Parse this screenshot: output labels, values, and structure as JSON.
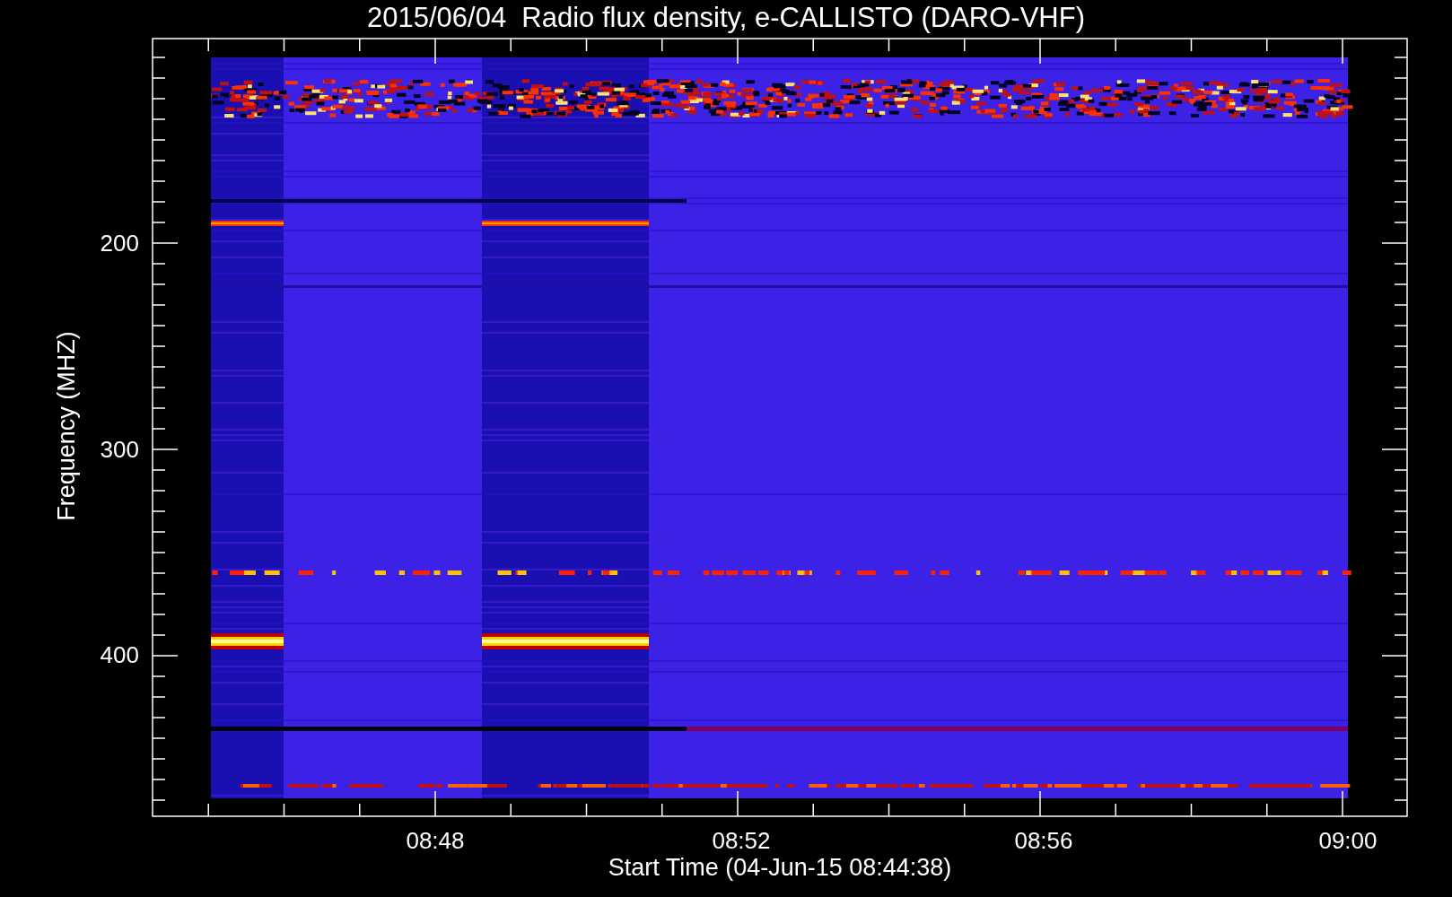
{
  "title": "2015/06/04  Radio flux density, e-CALLISTO (DARO-VHF)",
  "plot": {
    "ylabel": "Frequency (MHZ)",
    "xlabel": "Start Time (04-Jun-15 08:44:38)",
    "yticks": [
      "200",
      "300",
      "400"
    ],
    "xticks": [
      "08:48",
      "08:52",
      "08:56",
      "09:00"
    ]
  }
}
